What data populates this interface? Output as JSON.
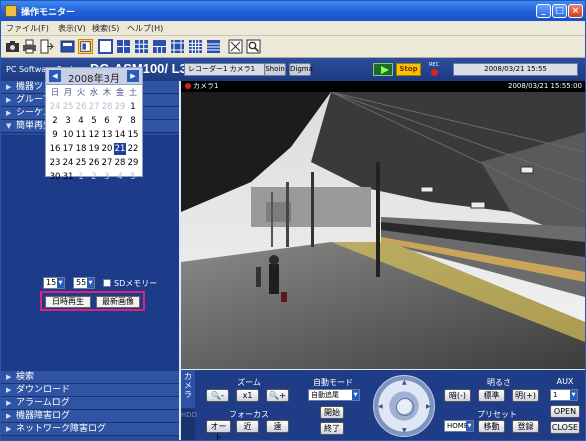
{
  "window": {
    "title": "操作モニター"
  },
  "menu": [
    "ファイル(F)",
    "表示(V)",
    "検索(S)",
    "ヘルプ(H)"
  ],
  "toolbar_icons": [
    "camera-icon",
    "print-icon",
    "exit-icon",
    "single-view-icon",
    "split-view-icon",
    "layout-1-icon",
    "layout-4-icon",
    "layout-9-icon",
    "layout-10-icon",
    "layout-13-icon",
    "layout-16-icon",
    "layout-list-icon",
    "fullscreen-icon",
    "zoom-icon"
  ],
  "header": {
    "package": "PC Software Package",
    "model": "DG-ASM100/ L3",
    "recorder": "レコーダー1 カメラ1",
    "chip1": "Shoin",
    "chip2": "Digma",
    "stop": "Stop",
    "rec": "REC",
    "date": "2008/03/21 15:55"
  },
  "sidebar": {
    "top_items": [
      {
        "label": "機器ツリー",
        "arrow": "▶"
      },
      {
        "label": "グループ",
        "arrow": "▶"
      },
      {
        "label": "シーケンス",
        "arrow": "▶"
      },
      {
        "label": "簡単再生",
        "arrow": "▼"
      }
    ],
    "bottom_items": [
      {
        "label": "検索"
      },
      {
        "label": "ダウンロード"
      },
      {
        "label": "アラームログ"
      },
      {
        "label": "機器障害ログ"
      },
      {
        "label": "ネットワーク障害ログ"
      }
    ]
  },
  "calendar": {
    "title": "2008年3月",
    "prev": "◀",
    "next": "▶",
    "weekdays": [
      "日",
      "月",
      "火",
      "水",
      "木",
      "金",
      "土"
    ],
    "rows": [
      [
        "24",
        "25",
        "26",
        "27",
        "28",
        "29",
        "1"
      ],
      [
        "2",
        "3",
        "4",
        "5",
        "6",
        "7",
        "8"
      ],
      [
        "9",
        "10",
        "11",
        "12",
        "13",
        "14",
        "15"
      ],
      [
        "16",
        "17",
        "18",
        "19",
        "20",
        "21",
        "22"
      ],
      [
        "23",
        "24",
        "25",
        "26",
        "27",
        "28",
        "29"
      ],
      [
        "30",
        "31",
        "1",
        "2",
        "3",
        "4",
        "5"
      ]
    ],
    "selected": "21"
  },
  "playback": {
    "hour": "15",
    "minute": "55",
    "sd_label": "SDメモリー",
    "datetime_play": "日時再生",
    "latest_image": "最新画像"
  },
  "video": {
    "camera_label": "カメラ1",
    "timestamp": "2008/03/21 15:55:00"
  },
  "controls": {
    "cam_tab": "カメラ",
    "hdd_tab": "HDD",
    "zoom_label": "ズーム",
    "zoom_out": "🔍-",
    "zoom_x1": "x1",
    "zoom_in": "🔍+",
    "focus_label": "フォーカス",
    "focus_auto": "オート",
    "focus_near": "近",
    "focus_far": "遠",
    "auto_mode_label": "自動モード",
    "auto_mode_value": "自動追尾",
    "auto_start": "開始",
    "auto_end": "終了",
    "brightness_label": "明るさ",
    "bright_dark": "暗(-)",
    "bright_std": "標準",
    "bright_light": "明(+)",
    "preset_label": "プリセット",
    "preset_value": "HOME",
    "preset_move": "移動",
    "preset_register": "登録",
    "aux_label": "AUX",
    "aux_value": "1",
    "aux_open": "OPEN",
    "aux_close": "CLOSE"
  }
}
